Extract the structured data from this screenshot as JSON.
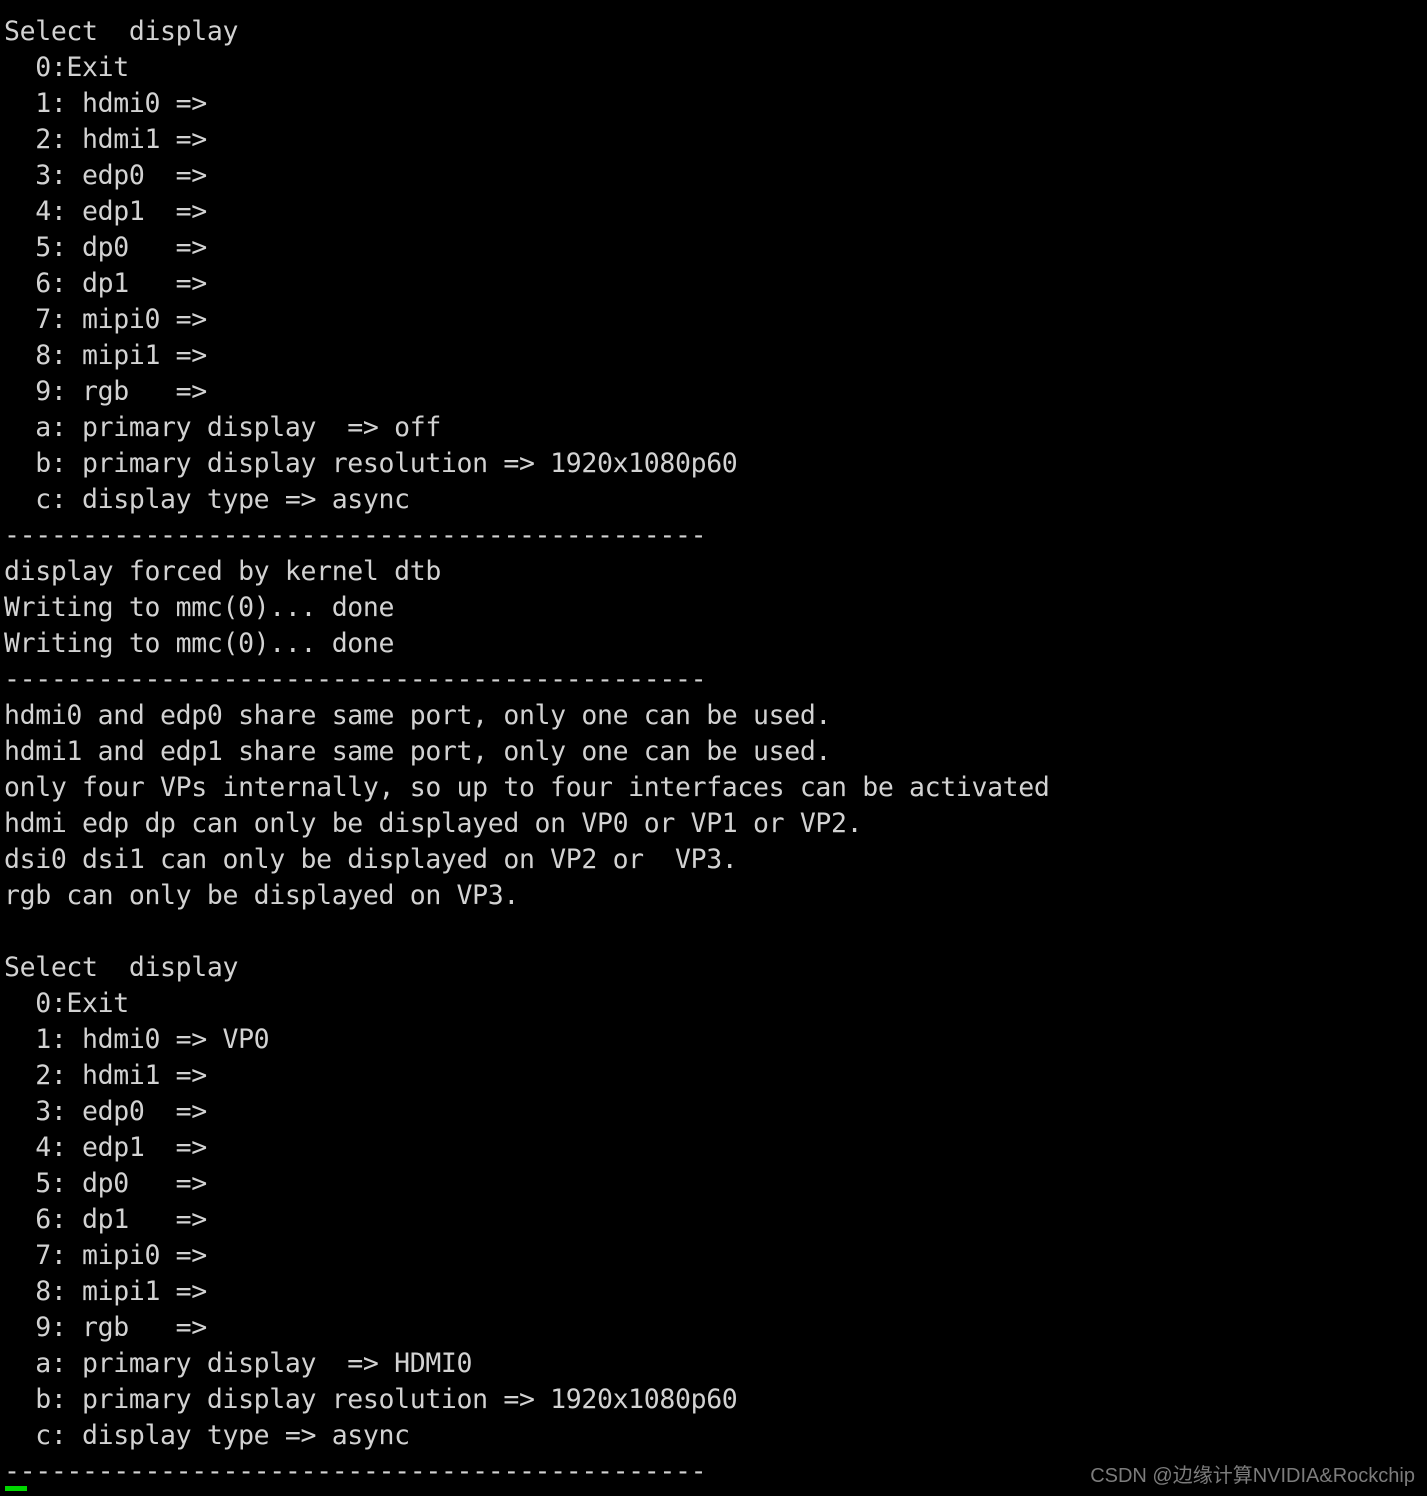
{
  "terminal": {
    "background_color": "#000000",
    "text_color": "#d2d2d2",
    "cursor_color": "#00d800",
    "lines": [
      "Select  display",
      "  0:Exit",
      "  1: hdmi0 =>",
      "  2: hdmi1 =>",
      "  3: edp0  =>",
      "  4: edp1  =>",
      "  5: dp0   =>",
      "  6: dp1   =>",
      "  7: mipi0 =>",
      "  8: mipi1 =>",
      "  9: rgb   =>",
      "  a: primary display  => off",
      "  b: primary display resolution => 1920x1080p60",
      "  c: display type => async",
      "---------------------------------------------",
      "display forced by kernel dtb",
      "Writing to mmc(0)... done",
      "Writing to mmc(0)... done",
      "---------------------------------------------",
      "hdmi0 and edp0 share same port, only one can be used.",
      "hdmi1 and edp1 share same port, only one can be used.",
      "only four VPs internally, so up to four interfaces can be activated",
      "hdmi edp dp can only be displayed on VP0 or VP1 or VP2.",
      "dsi0 dsi1 can only be displayed on VP2 or  VP3.",
      "rgb can only be displayed on VP3.",
      "",
      "Select  display",
      "  0:Exit",
      "  1: hdmi0 => VP0",
      "  2: hdmi1 =>",
      "  3: edp0  =>",
      "  4: edp1  =>",
      "  5: dp0   =>",
      "  6: dp1   =>",
      "  7: mipi0 =>",
      "  8: mipi1 =>",
      "  9: rgb   =>",
      "  a: primary display  => HDMI0",
      "  b: primary display resolution => 1920x1080p60",
      "  c: display type => async",
      "---------------------------------------------"
    ]
  },
  "watermark": {
    "text": "CSDN @边缘计算NVIDIA&Rockchip"
  }
}
